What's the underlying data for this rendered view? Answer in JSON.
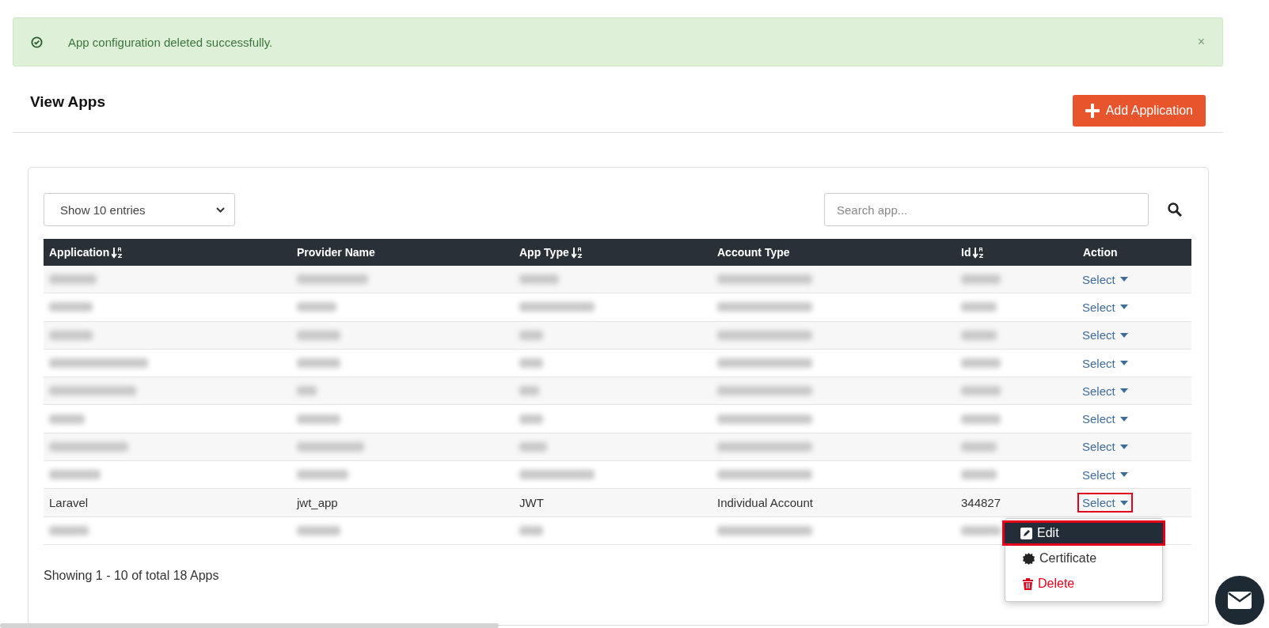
{
  "alert": {
    "message": "App configuration deleted successfully.",
    "dismissible": true,
    "close_label": "×"
  },
  "page_title": "View Apps",
  "add_button": {
    "label": "Add Application"
  },
  "entries_select": {
    "value": "Show 10 entries"
  },
  "search": {
    "placeholder": "Search app..."
  },
  "table": {
    "columns": [
      {
        "label": "Application",
        "sortable": true
      },
      {
        "label": "Provider Name",
        "sortable": false
      },
      {
        "label": "App Type",
        "sortable": true
      },
      {
        "label": "Account Type",
        "sortable": false
      },
      {
        "label": "Id",
        "sortable": true
      },
      {
        "label": "Action",
        "sortable": false
      }
    ],
    "rows": [
      {
        "redacted": true,
        "action": {
          "label": "Select",
          "highlighted": false
        }
      },
      {
        "redacted": true,
        "action": {
          "label": "Select",
          "highlighted": false
        }
      },
      {
        "redacted": true,
        "action": {
          "label": "Select",
          "highlighted": false
        }
      },
      {
        "redacted": true,
        "action": {
          "label": "Select",
          "highlighted": false
        }
      },
      {
        "redacted": true,
        "action": {
          "label": "Select",
          "highlighted": false
        }
      },
      {
        "redacted": true,
        "action": {
          "label": "Select",
          "highlighted": false
        }
      },
      {
        "redacted": true,
        "action": {
          "label": "Select",
          "highlighted": false
        }
      },
      {
        "redacted": true,
        "action": {
          "label": "Select",
          "highlighted": false
        }
      },
      {
        "redacted": false,
        "cells": [
          "Laravel",
          "jwt_app",
          "JWT",
          "Individual Account",
          "344827"
        ],
        "action": {
          "label": "Select",
          "highlighted": true,
          "menu": [
            {
              "kind": "edit",
              "label": "Edit",
              "selected": true,
              "highlighted": true
            },
            {
              "kind": "certificate",
              "label": "Certificate",
              "selected": false,
              "highlighted": false
            },
            {
              "kind": "delete",
              "label": "Delete",
              "selected": false,
              "highlighted": false
            }
          ]
        }
      },
      {
        "redacted": true
      }
    ]
  },
  "footer": {
    "summary": "Showing 1 - 10 of total 18 Apps"
  }
}
